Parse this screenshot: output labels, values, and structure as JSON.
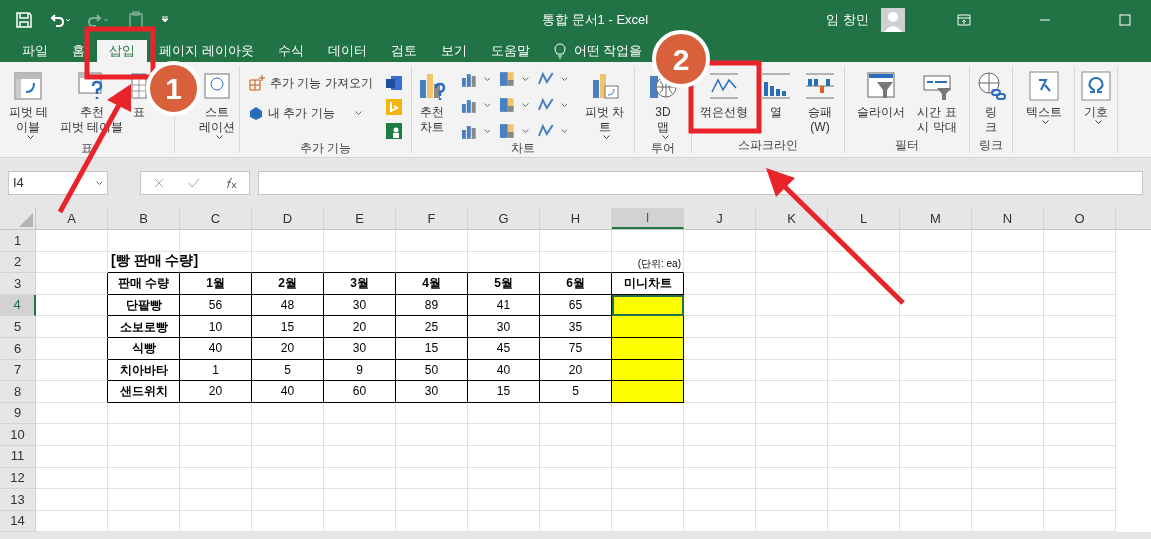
{
  "title_bar": {
    "title": "통합 문서1  -  Excel",
    "user": "임 창민"
  },
  "tabs": [
    {
      "label": "파일",
      "selected": false
    },
    {
      "label": "홈",
      "selected": false
    },
    {
      "label": "삽입",
      "selected": true
    },
    {
      "label": "페이지 레이아웃",
      "selected": false
    },
    {
      "label": "수식",
      "selected": false
    },
    {
      "label": "데이터",
      "selected": false
    },
    {
      "label": "검토",
      "selected": false
    },
    {
      "label": "보기",
      "selected": false
    },
    {
      "label": "도움말",
      "selected": false
    }
  ],
  "tell_me": "어떤 작업을",
  "ribbon": {
    "groups": [
      {
        "label": "표",
        "buttons": [
          {
            "kind": "large",
            "label": "피벗 테\n이블",
            "dropdown": true
          },
          {
            "kind": "large",
            "label": "추천\n피벗 테이블",
            "dropdown": false
          },
          {
            "kind": "large",
            "label": "표",
            "dropdown": false
          }
        ]
      },
      {
        "buttons": [
          {
            "kind": "large",
            "label": "스트\n레이션",
            "dropdown": true
          }
        ]
      },
      {
        "label": "추가 기능",
        "buttons": [
          {
            "kind": "small",
            "label": "추가 기능 가져오기",
            "dropdown": false
          },
          {
            "kind": "small",
            "label": "내 추가 기능",
            "dropdown": true
          },
          {
            "kind": "icons"
          }
        ]
      },
      {
        "label": "차트",
        "buttons": [
          {
            "kind": "large",
            "label": "추천\n차트",
            "dropdown": false
          },
          {
            "kind": "chartgrid"
          },
          {
            "kind": "large",
            "label": "피벗 차트",
            "dropdown": true
          }
        ]
      },
      {
        "label": "투어",
        "buttons": [
          {
            "kind": "large",
            "label": "3D\n맵",
            "dropdown": true
          }
        ]
      },
      {
        "label": "스파크라인",
        "buttons": [
          {
            "kind": "large",
            "label": "꺾은선형",
            "dropdown": false
          },
          {
            "kind": "large",
            "label": "열",
            "dropdown": false
          },
          {
            "kind": "large",
            "label": "승패\n(W)",
            "dropdown": false
          }
        ]
      },
      {
        "label": "필터",
        "buttons": [
          {
            "kind": "large",
            "label": "슬라이서",
            "dropdown": false
          },
          {
            "kind": "large",
            "label": "시간 표\n시 막대",
            "dropdown": false
          }
        ]
      },
      {
        "label": "링크",
        "buttons": [
          {
            "kind": "large",
            "label": "링\n크",
            "dropdown": false
          }
        ]
      },
      {
        "buttons": [
          {
            "kind": "large",
            "label": "텍스트",
            "dropdown": true
          }
        ]
      },
      {
        "buttons": [
          {
            "kind": "large",
            "label": "기호",
            "dropdown": true
          }
        ]
      }
    ]
  },
  "name_box": "I4",
  "columns": [
    {
      "label": "A",
      "selected": false
    },
    {
      "label": "B",
      "selected": false
    },
    {
      "label": "C",
      "selected": false
    },
    {
      "label": "D",
      "selected": false
    },
    {
      "label": "E",
      "selected": false
    },
    {
      "label": "F",
      "selected": false
    },
    {
      "label": "G",
      "selected": false
    },
    {
      "label": "H",
      "selected": false
    },
    {
      "label": "I",
      "selected": true
    },
    {
      "label": "J",
      "selected": false
    },
    {
      "label": "K",
      "selected": false
    },
    {
      "label": "L",
      "selected": false
    },
    {
      "label": "M",
      "selected": false
    },
    {
      "label": "N",
      "selected": false
    },
    {
      "label": "O",
      "selected": false
    }
  ],
  "rows": [
    {
      "label": "1",
      "selected": false
    },
    {
      "label": "2",
      "selected": false
    },
    {
      "label": "3",
      "selected": false
    },
    {
      "label": "4",
      "selected": true
    },
    {
      "label": "5",
      "selected": false
    },
    {
      "label": "6",
      "selected": false
    },
    {
      "label": "7",
      "selected": false
    },
    {
      "label": "8",
      "selected": false
    },
    {
      "label": "9",
      "selected": false
    },
    {
      "label": "10",
      "selected": false
    },
    {
      "label": "11",
      "selected": false
    },
    {
      "label": "12",
      "selected": false
    },
    {
      "label": "13",
      "selected": false
    },
    {
      "label": "14",
      "selected": false
    }
  ],
  "sheet": {
    "title": "[빵 판매 수량]",
    "unit": "(단위: ea)",
    "header": [
      "판매 수량",
      "1월",
      "2월",
      "3월",
      "4월",
      "5월",
      "6월",
      "미니차트"
    ],
    "rows": [
      {
        "cells": [
          "단팥빵",
          "56",
          "48",
          "30",
          "89",
          "41",
          "65"
        ],
        "selected": true
      },
      {
        "cells": [
          "소보로빵",
          "10",
          "15",
          "20",
          "25",
          "30",
          "35"
        ],
        "selected": false
      },
      {
        "cells": [
          "식빵",
          "40",
          "20",
          "30",
          "15",
          "45",
          "75"
        ],
        "selected": false
      },
      {
        "cells": [
          "치아바타",
          "1",
          "5",
          "9",
          "50",
          "40",
          "20"
        ],
        "selected": false
      },
      {
        "cells": [
          "샌드위치",
          "20",
          "40",
          "60",
          "30",
          "15",
          "5"
        ],
        "selected": false
      }
    ]
  },
  "annotations": [
    {
      "number": "1"
    },
    {
      "number": "2"
    }
  ]
}
